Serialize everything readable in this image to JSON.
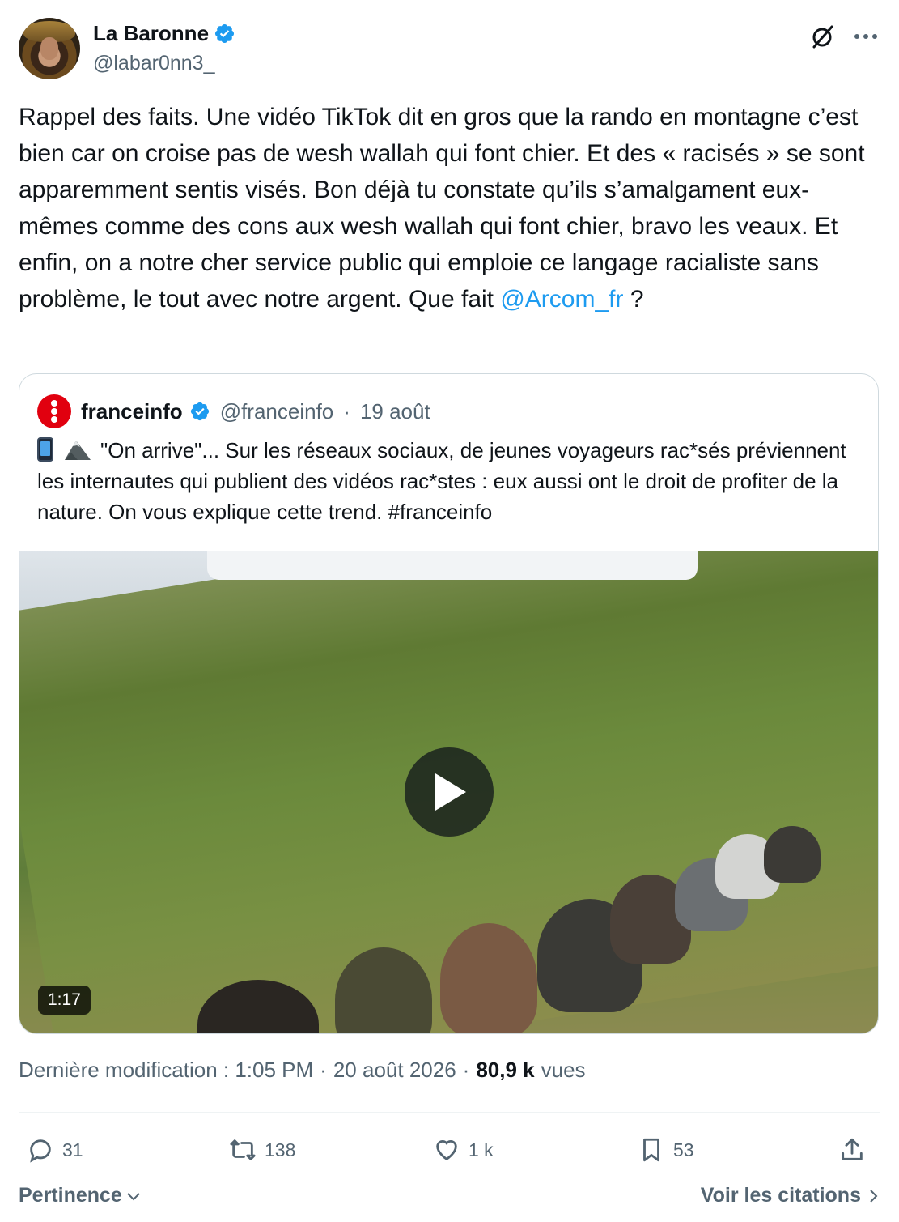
{
  "author": {
    "display_name": "La Baronne",
    "handle": "@labar0nn3_",
    "verified": true
  },
  "tweet": {
    "text_main": "Rappel des faits. Une vidéo TikTok dit en gros que la rando en montagne c’est bien car on croise pas de wesh wallah qui font chier. Et des « racisés » se sont apparemment sentis visés. Bon déjà tu constate qu’ils s’amalgament eux-mêmes comme des cons aux wesh wallah qui font chier, bravo les veaux. Et enfin, on a notre cher service public qui emploie ce langage racialiste sans problème, le tout avec notre argent. Que fait ",
    "mention": "@Arcom_fr",
    "text_end": " ?"
  },
  "quote": {
    "name": "franceinfo",
    "handle": "@franceinfo",
    "separator": "·",
    "date": "19 août",
    "verified": true,
    "text": "\"On arrive\"... Sur les réseaux sociaux, de jeunes voyageurs rac*sés préviennent les internautes qui publient des vidéos rac*stes : eux aussi ont le droit de profiter de la nature. On vous explique cette trend. #franceinfo",
    "emojis": [
      "phone-emoji",
      "mountain-emoji"
    ],
    "video": {
      "duration": "1:17"
    }
  },
  "meta": {
    "edited_label": "Dernière modification : 1:05 PM",
    "separator": "·",
    "date": "20 août 2026",
    "views_count": "80,9 k",
    "views_label": "vues"
  },
  "actions": {
    "replies": "31",
    "reposts": "138",
    "likes": "1 k",
    "bookmarks": "53"
  },
  "footer": {
    "sort_label": "Pertinence",
    "quotes_label": "Voir les citations"
  },
  "colors": {
    "accent": "#1d9bf0",
    "text": "#0f1419",
    "secondary": "#536471",
    "border": "#cfd9de",
    "franceinfo_red": "#e1000f"
  }
}
